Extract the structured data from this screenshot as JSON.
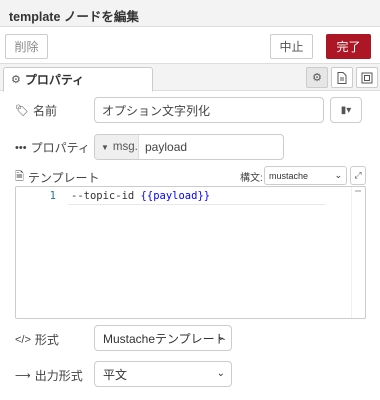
{
  "header": {
    "title": "template ノードを編集"
  },
  "toolbar": {
    "delete_label": "削除",
    "cancel_label": "中止",
    "done_label": "完了"
  },
  "tabs": [
    {
      "label": "プロパティ",
      "icon": "gear-icon"
    }
  ],
  "tab_icons": [
    "gear-icon",
    "document-icon",
    "layout-icon"
  ],
  "form": {
    "name": {
      "label": "名前",
      "value": "オプション文字列化",
      "icon": "tag-icon"
    },
    "property": {
      "label": "プロパティ",
      "type": "msg.",
      "value": "payload",
      "icon": "ellipsis-icon"
    },
    "template": {
      "label": "テンプレート",
      "icon": "file-code-icon",
      "syntax_label": "構文:",
      "syntax_value": "mustache",
      "lines": [
        {
          "number": "1",
          "prefix": "--topic-id ",
          "mustache": "{{payload}}"
        }
      ]
    },
    "format": {
      "label": "形式",
      "value": "Mustacheテンプレート",
      "icon": "code-icon"
    },
    "output": {
      "label": "出力形式",
      "value": "平文",
      "icon": "arrow-right-icon"
    }
  },
  "colors": {
    "accent": "#ad1625",
    "mustache_token": "#0000ff"
  }
}
